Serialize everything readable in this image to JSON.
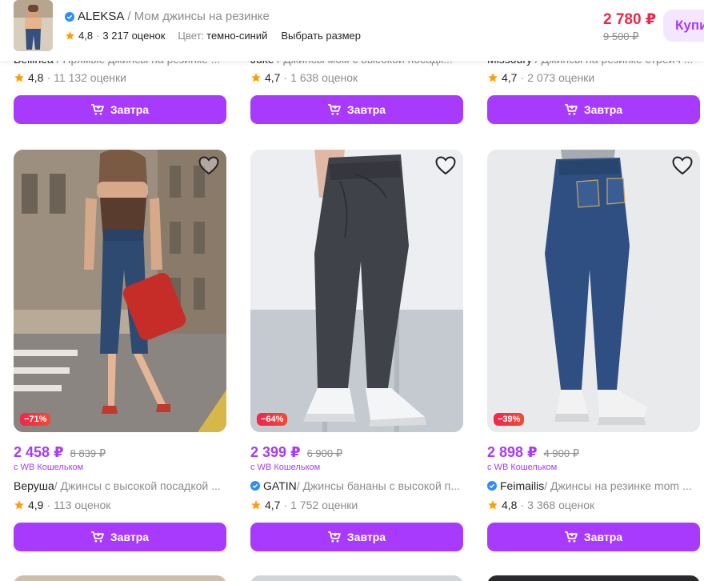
{
  "header": {
    "brand": "ALEKSA",
    "product": "/ Мом джинсы на резинке",
    "rating": "4,8",
    "reviews": "3 217 оценок",
    "color_label": "Цвет:",
    "color_value": "темно-синий",
    "size_link": "Выбрать размер",
    "price": "2 780 ₽",
    "old_price": "9 500 ₽",
    "buy_label": "Купить"
  },
  "top_row": [
    {
      "seller": "Bellinea",
      "desc": " / Прямые джинсы на резинке ...",
      "rating": "4,8",
      "reviews": "11 132 оценки",
      "button": "Завтра"
    },
    {
      "seller": "Juke",
      "desc": " / Джинсы мом с высокой посадк...",
      "rating": "4,7",
      "reviews": "1 638 оценок",
      "button": "Завтра"
    },
    {
      "seller": "Missoury",
      "desc": " / Джинсы на резинке стрейч ...",
      "rating": "4,7",
      "reviews": "2 073 оценки",
      "button": "Завтра"
    }
  ],
  "products": [
    {
      "discount": "−71%",
      "price": "2 458 ₽",
      "old_price": "8 839 ₽",
      "wallet": "с WB Кошельком",
      "seller": "Веруша",
      "desc": " / Джинсы с высокой посадкой ...",
      "rating": "4,9",
      "reviews": "113 оценок",
      "button": "Завтра"
    },
    {
      "discount": "−64%",
      "price": "2 399 ₽",
      "old_price": "6 900 ₽",
      "wallet": "с WB Кошельком",
      "seller": "GATIN",
      "desc": " / Джинсы бананы с высокой п...",
      "rating": "4,7",
      "reviews": "1 752 оценки",
      "button": "Завтра"
    },
    {
      "discount": "−39%",
      "price": "2 898 ₽",
      "old_price": "4 900 ₽",
      "wallet": "с WB Кошельком",
      "seller": "Feimailis",
      "desc": " / Джинсы на резинке mom ...",
      "rating": "4,8",
      "reviews": "3 368 оценок",
      "button": "Завтра"
    }
  ],
  "colors": {
    "accent": "#a73afd",
    "price_red": "#f0264a",
    "star": "#ff9c00",
    "muted": "#8c8c8c"
  },
  "icons": [
    "cart-icon",
    "star-icon",
    "heart-icon",
    "verified-icon"
  ]
}
